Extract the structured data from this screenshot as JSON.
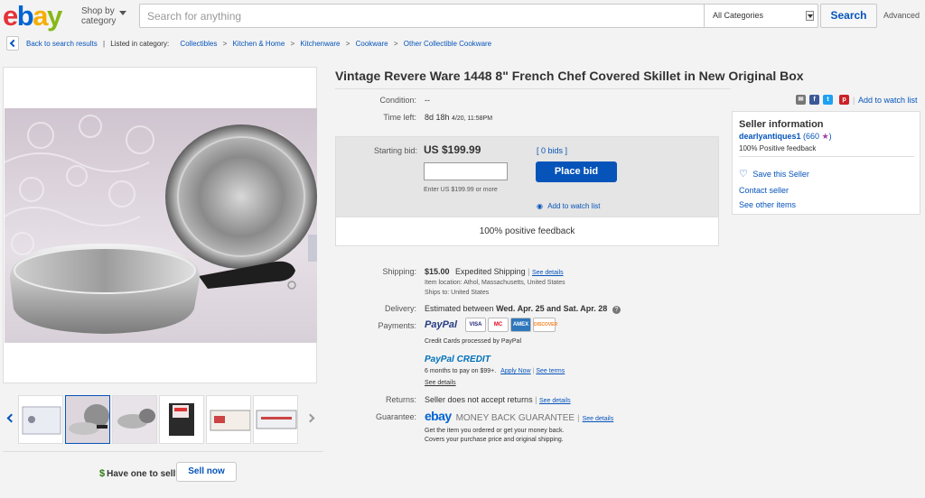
{
  "header": {
    "shop_by": "Shop by category",
    "search_placeholder": "Search for anything",
    "category": "All Categories",
    "search_label": "Search",
    "advanced_label": "Advanced"
  },
  "breadcrumb": {
    "back_label": "Back to search results",
    "listed_in": "Listed in category:",
    "items": [
      "Collectibles",
      "Kitchen & Home",
      "Kitchenware",
      "Cookware",
      "Other Collectible Cookware"
    ]
  },
  "item": {
    "title": "Vintage Revere Ware 1448 8\" French Chef Covered Skillet in New Original Box",
    "condition_label": "Condition:",
    "condition_value": "--",
    "time_left_label": "Time left:",
    "time_left_value": "8d 18h",
    "time_left_date": "4/20, 11:58PM"
  },
  "bid": {
    "starting_bid_label": "Starting bid:",
    "starting_bid_value": "US $199.99",
    "bids_count": "[ 0 bids ]",
    "place_bid_label": "Place bid",
    "enter_hint": "Enter US $199.99 or more",
    "watch_label": "Add to watch list",
    "positive_feedback": "100% positive feedback"
  },
  "share": {
    "add_watch_list": "Add to watch list"
  },
  "seller": {
    "heading": "Seller information",
    "name": "dearlyantiques1",
    "score": "(660",
    "score_close": ")",
    "feedback": "100% Positive feedback",
    "save_label": "Save this Seller",
    "contact_label": "Contact seller",
    "other_items_label": "See other items"
  },
  "shipping": {
    "label": "Shipping:",
    "price": "$15.00",
    "service": "Expedited Shipping",
    "details": "See details",
    "location": "Item location:  Athol, Massachusetts, United States",
    "ships_to": "Ships to:  United States"
  },
  "delivery": {
    "label": "Delivery:",
    "prefix": "Estimated between",
    "dates": "Wed. Apr. 25 and Sat. Apr. 28"
  },
  "payments": {
    "label": "Payments:",
    "paypal": "PayPal",
    "cards": [
      "VISA",
      "MC",
      "AMEX",
      "DISCOVER"
    ],
    "processed": "Credit Cards processed by PayPal",
    "credit_logo": "PayPal CREDIT",
    "credit_text": "6 months to pay on $99+.",
    "apply_now": "Apply Now",
    "see_terms": "See terms",
    "see_details": "See details"
  },
  "returns": {
    "label": "Returns:",
    "value": "Seller does not accept returns",
    "details": "See details"
  },
  "guarantee": {
    "label": "Guarantee:",
    "logo": "ebay",
    "mbg": "MONEY BACK GUARANTEE",
    "details": "See details",
    "line1": "Get the item you ordered or get your money back.",
    "line2": "Covers your purchase price and original shipping."
  },
  "sell": {
    "question": "Have one to sell?",
    "button": "Sell now"
  },
  "colors": {
    "link": "#0654ba",
    "place_bid": "#0654ba",
    "ebay_red": "#e53238",
    "ebay_blue": "#0064d2",
    "ebay_yellow": "#f5af02",
    "ebay_green": "#86b817"
  }
}
